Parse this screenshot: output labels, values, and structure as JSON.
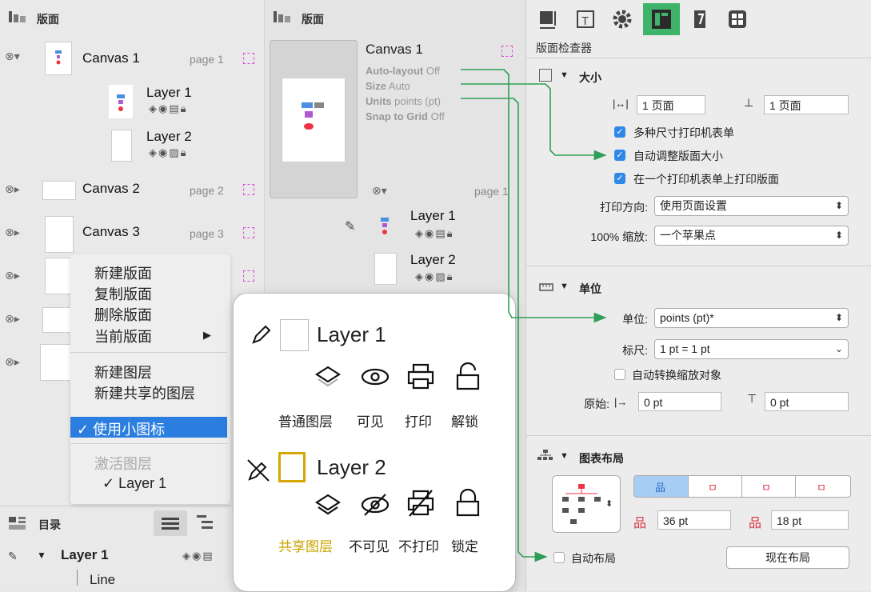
{
  "left_panel": {
    "header": "版面",
    "canvases": [
      {
        "name": "Canvas 1",
        "page": "page 1"
      },
      {
        "name": "Canvas 2",
        "page": "page 2"
      },
      {
        "name": "Canvas 3",
        "page": "page 3"
      }
    ],
    "layers": [
      "Layer 1",
      "Layer 2"
    ]
  },
  "context_menu": {
    "items": [
      "新建版面",
      "复制版面",
      "删除版面",
      "当前版面"
    ],
    "layer_items": [
      "新建图层",
      "新建共享的图层"
    ],
    "selected": "✓ 使用小图标",
    "disabled": "激活图层",
    "sub_checked": "✓ Layer 1",
    "submenu_arrow": "▶"
  },
  "outline": {
    "header": "目录",
    "layer": "Layer 1",
    "child": "Line"
  },
  "mid_panel": {
    "header": "版面",
    "canvas_title": "Canvas 1",
    "props": [
      {
        "key": "Auto-layout",
        "val": "Off"
      },
      {
        "key": "Size",
        "val": "Auto"
      },
      {
        "key": "Units",
        "val": "points (pt)"
      },
      {
        "key": "Snap to Grid",
        "val": "Off"
      }
    ],
    "page": "page 1",
    "layers": [
      "Layer 1",
      "Layer 2"
    ]
  },
  "popup": {
    "layer1": "Layer 1",
    "layer2": "Layer 2",
    "row1_labels": [
      "普通图层",
      "可见",
      "打印",
      "解锁"
    ],
    "row2_labels": [
      "共享图层",
      "不可见",
      "不打印",
      "锁定"
    ],
    "shared_color": "#c9a400"
  },
  "inspector": {
    "title": "版面检查器",
    "size_section": "大小",
    "width_pages": "1 页面",
    "height_pages": "1 页面",
    "checks": [
      {
        "label": "多种尺寸打印机表单",
        "checked": true
      },
      {
        "label": "自动调整版面大小",
        "checked": true
      },
      {
        "label": "在一个打印机表单上打印版面",
        "checked": true
      }
    ],
    "orientation_label": "打印方向:",
    "orientation_value": "使用页面设置",
    "scale_label": "100% 缩放:",
    "scale_value": "一个苹果点",
    "units_section": "单位",
    "unit_label": "单位:",
    "unit_value": "points (pt)*",
    "ruler_label": "标尺:",
    "ruler_value": "1 pt = 1 pt",
    "auto_convert": "自动转换缩放对象",
    "origin_label": "原始:",
    "origin_x": "0 pt",
    "origin_y": "0 pt",
    "layout_section": "图表布局",
    "spacing_h": "36 pt",
    "spacing_v": "18 pt",
    "auto_layout": "自动布局",
    "layout_now": "现在布局",
    "accent": "#2e9e56",
    "selected_tab_color": "#3fb36a"
  }
}
